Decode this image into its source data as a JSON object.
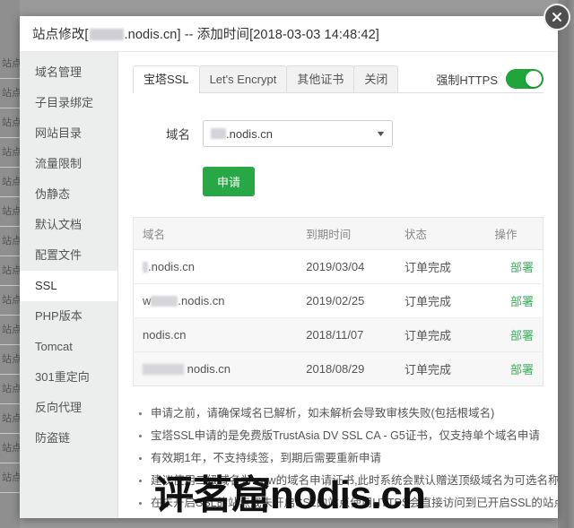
{
  "window": {
    "title_prefix": "站点修改[",
    "title_domain": ".nodis.cn]",
    "title_suffix": " -- 添加时间[2018-03-03 14:48:42]",
    "close_icon": "close-icon"
  },
  "backdrop": {
    "rows": [
      "站点",
      "站点",
      "站点",
      "站点",
      "站点",
      "站点",
      "站点",
      "站点",
      "站点",
      "站点",
      "站点",
      "站点",
      "站点",
      "站点",
      "站点"
    ]
  },
  "sidebar": {
    "items": [
      {
        "label": "域名管理",
        "active": false
      },
      {
        "label": "子目录绑定",
        "active": false
      },
      {
        "label": "网站目录",
        "active": false
      },
      {
        "label": "流量限制",
        "active": false
      },
      {
        "label": "伪静态",
        "active": false
      },
      {
        "label": "默认文档",
        "active": false
      },
      {
        "label": "配置文件",
        "active": false
      },
      {
        "label": "SSL",
        "active": true
      },
      {
        "label": "PHP版本",
        "active": false
      },
      {
        "label": "Tomcat",
        "active": false
      },
      {
        "label": "301重定向",
        "active": false
      },
      {
        "label": "反向代理",
        "active": false
      },
      {
        "label": "防盗链",
        "active": false
      }
    ]
  },
  "tabs": [
    {
      "label": "宝塔SSL",
      "active": true
    },
    {
      "label": "Let's Encrypt",
      "active": false
    },
    {
      "label": "其他证书",
      "active": false
    },
    {
      "label": "关闭",
      "active": false
    }
  ],
  "force_https": {
    "label": "强制HTTPS",
    "enabled": true,
    "color_on": "#20a53a"
  },
  "form": {
    "domain_label": "域名",
    "domain_value": ".nodis.cn",
    "domain_caret": "chevron-down-icon",
    "apply_label": "申请",
    "apply_color": "#28a745"
  },
  "table": {
    "headers": [
      "域名",
      "到期时间",
      "状态",
      "操作"
    ],
    "rows": [
      {
        "domain": ".nodis.cn",
        "mask_width": 6,
        "expire": "2019/03/04",
        "status": "订单完成",
        "action": "部署",
        "striped": false
      },
      {
        "domain": ".nodis.cn",
        "prefix": "w",
        "mask_width": 30,
        "expire": "2019/02/25",
        "status": "订单完成",
        "action": "部署",
        "striped": false
      },
      {
        "domain": "nodis.cn",
        "mask_width": 0,
        "expire": "2018/11/07",
        "status": "订单完成",
        "action": "部署",
        "striped": true
      },
      {
        "domain": " nodis.cn",
        "mask_width": 46,
        "expire": "2018/08/29",
        "status": "订单完成",
        "action": "部署",
        "striped": true
      }
    ],
    "action_color": "#3bb25a"
  },
  "notes": [
    "申请之前，请确保域名已解析，如未解析会导致审核失败(包括根域名)",
    "宝塔SSL申请的是免费版TrustAsia DV SSL CA - G5证书，仅支持单个域名申请",
    "有效期1年，不支持续签，到期后需要重新申请",
    "建议使用二级域名为www的域名申请证书,此时系统会默认赠送顶级域名为可选名称",
    "在未开启SSL的站点或未开启SSL的站点使用HTTPS会直接访问到已开启SSL的站点"
  ],
  "watermark": {
    "text": "评茗窟nodis.cn"
  }
}
